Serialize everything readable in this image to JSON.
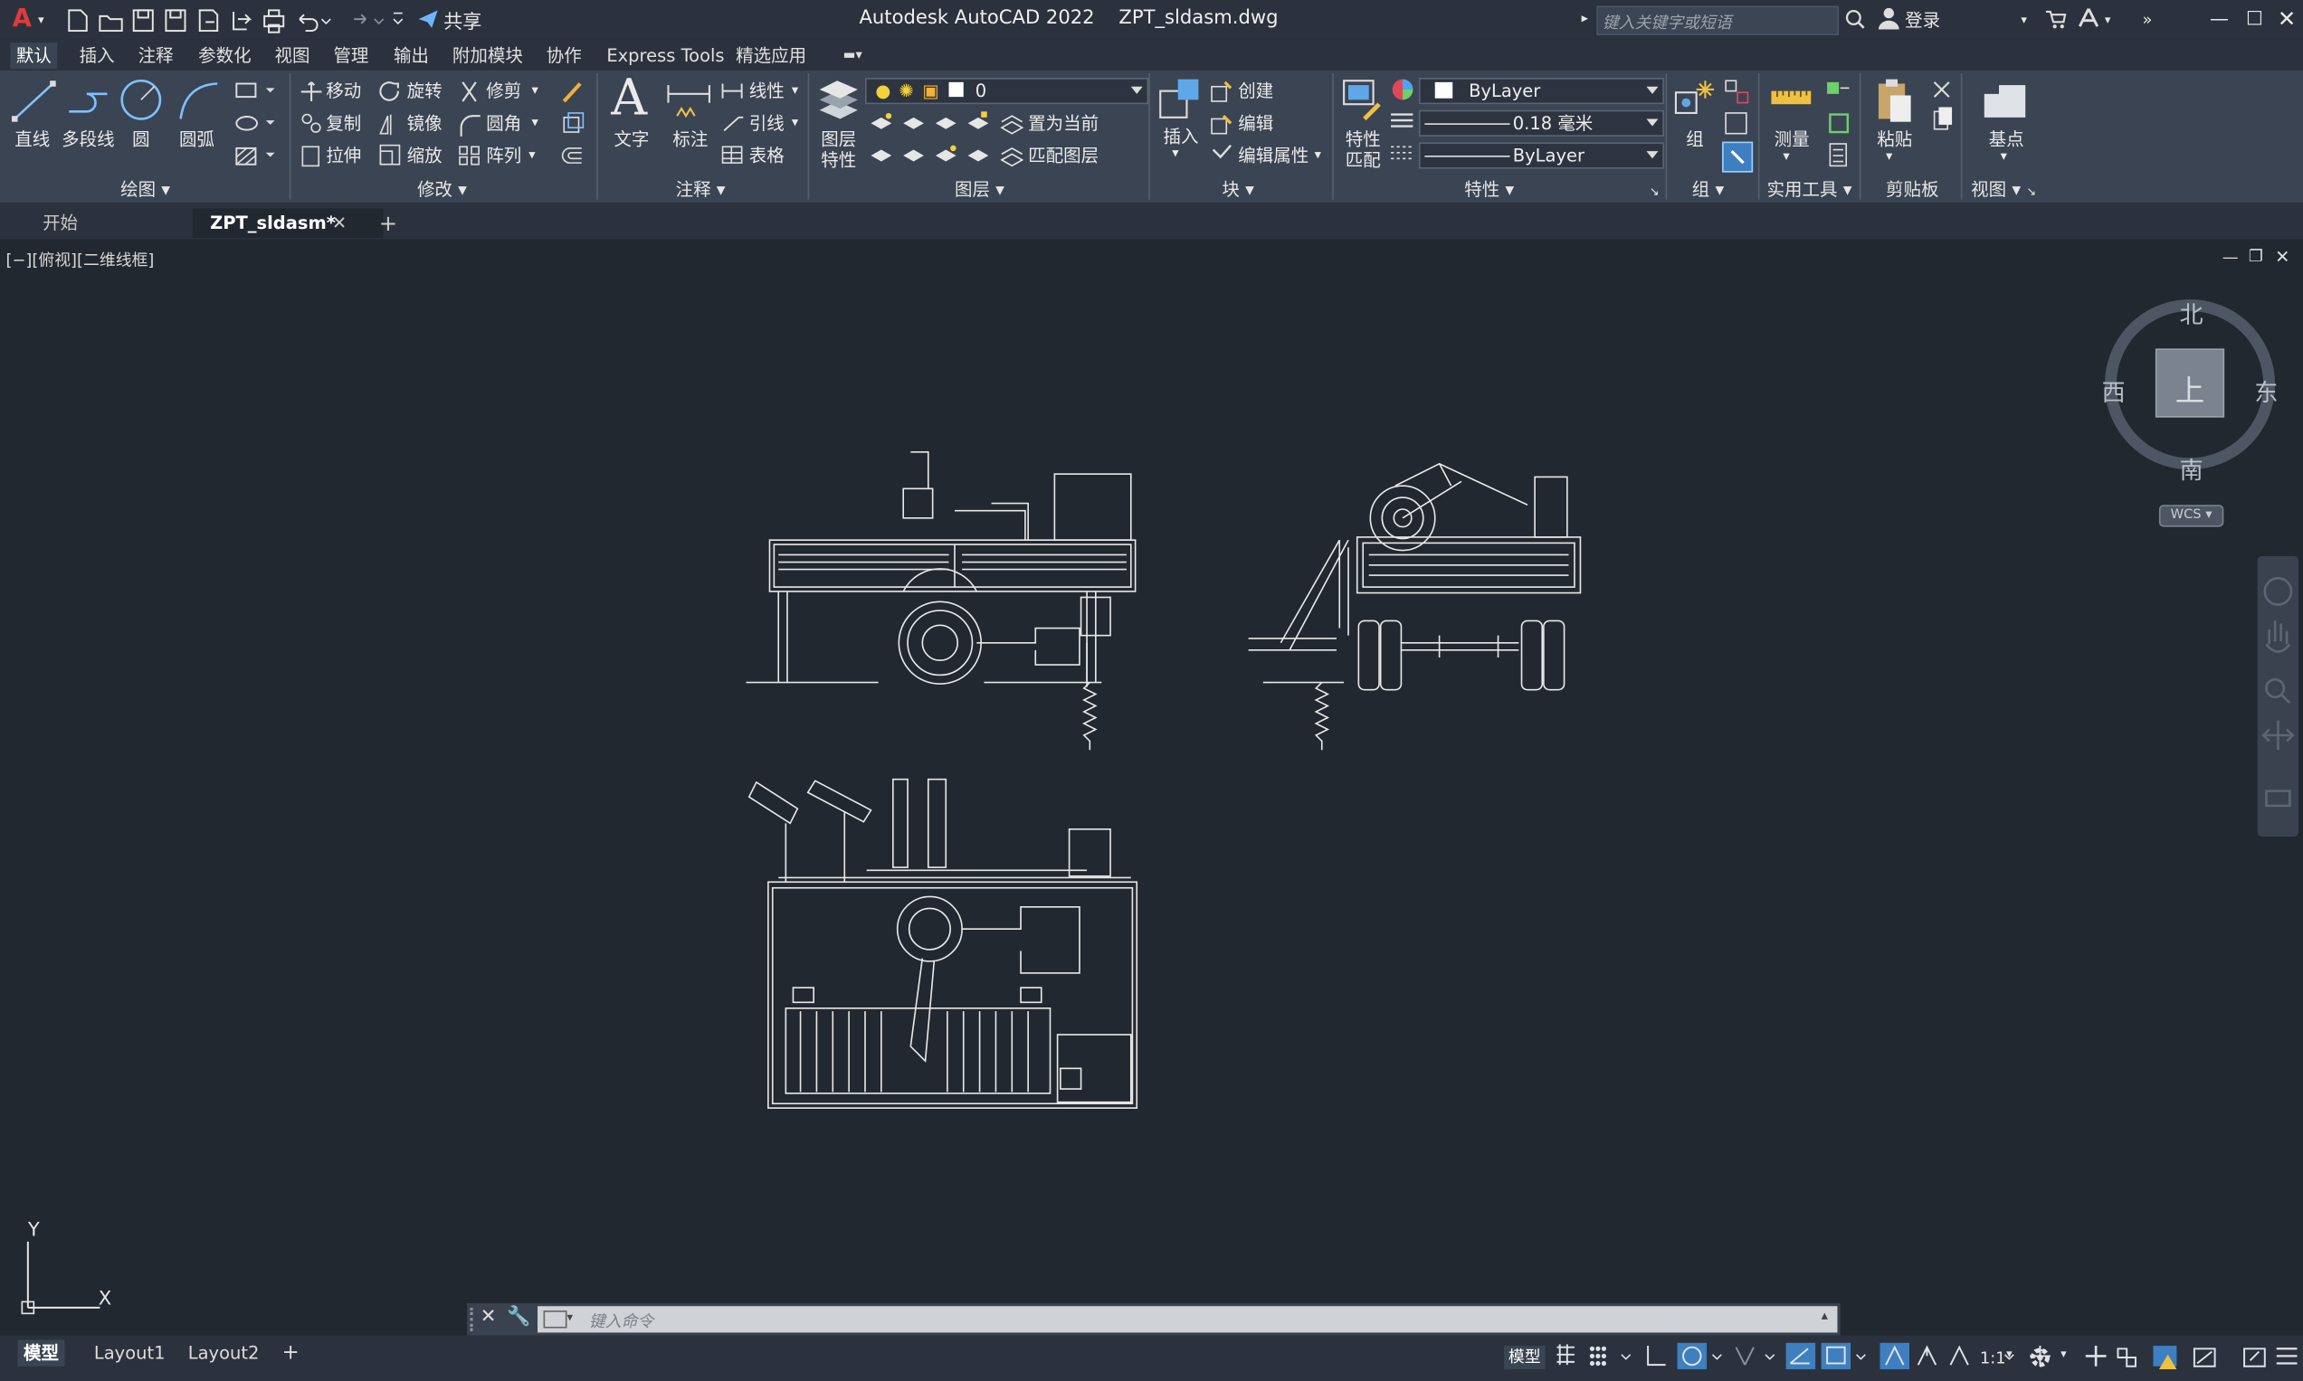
{
  "window": {
    "app_title": "Autodesk AutoCAD 2022    ZPT_sldasm.dwg",
    "share_label": "共享",
    "search_placeholder": "键入关键字或短语",
    "login_label": "登录"
  },
  "menu_tabs": [
    "默认",
    "插入",
    "注释",
    "参数化",
    "视图",
    "管理",
    "输出",
    "附加模块",
    "协作",
    "Express Tools",
    "精选应用"
  ],
  "ribbon": {
    "draw": {
      "title": "绘图",
      "line": "直线",
      "polyline": "多段线",
      "circle": "圆",
      "arc": "圆弧"
    },
    "modify": {
      "title": "修改",
      "move": "移动",
      "rotate": "旋转",
      "trim": "修剪",
      "copy": "复制",
      "mirror": "镜像",
      "fillet": "圆角",
      "stretch": "拉伸",
      "scale": "缩放",
      "array": "阵列"
    },
    "annotation": {
      "title": "注释",
      "text": "文字",
      "dimension": "标注",
      "linear": "线性",
      "leader": "引线",
      "table": "表格"
    },
    "layers": {
      "title": "图层",
      "layer_props_1": "图层",
      "layer_props_2": "特性",
      "current_layer": "0",
      "set_current": "置为当前",
      "match_layer": "匹配图层"
    },
    "block": {
      "title": "块",
      "insert": "插入",
      "create": "创建",
      "edit": "编辑",
      "edit_attr": "编辑属性"
    },
    "properties": {
      "title": "特性",
      "match_1": "特性",
      "match_2": "匹配",
      "color": "ByLayer",
      "lineweight": "0.18 毫米",
      "linetype": "ByLayer"
    },
    "groups": {
      "title": "组",
      "group": "组"
    },
    "utilities": {
      "title": "实用工具",
      "measure": "测量"
    },
    "clipboard": {
      "title": "剪贴板",
      "paste": "粘贴"
    },
    "view": {
      "title": "视图",
      "base": "基点"
    }
  },
  "doc_tabs": {
    "start": "开始",
    "file": "ZPT_sldasm*"
  },
  "viewport": {
    "label": "[−][俯视][二维线框]"
  },
  "viewcube": {
    "north": "北",
    "south": "南",
    "east": "东",
    "west": "西",
    "face": "上",
    "wcs": "WCS"
  },
  "ucs": {
    "x": "X",
    "y": "Y"
  },
  "command": {
    "placeholder": "键入命令"
  },
  "layout_tabs": [
    "模型",
    "Layout1",
    "Layout2"
  ],
  "status": {
    "model": "模型",
    "scale": "1:1"
  }
}
